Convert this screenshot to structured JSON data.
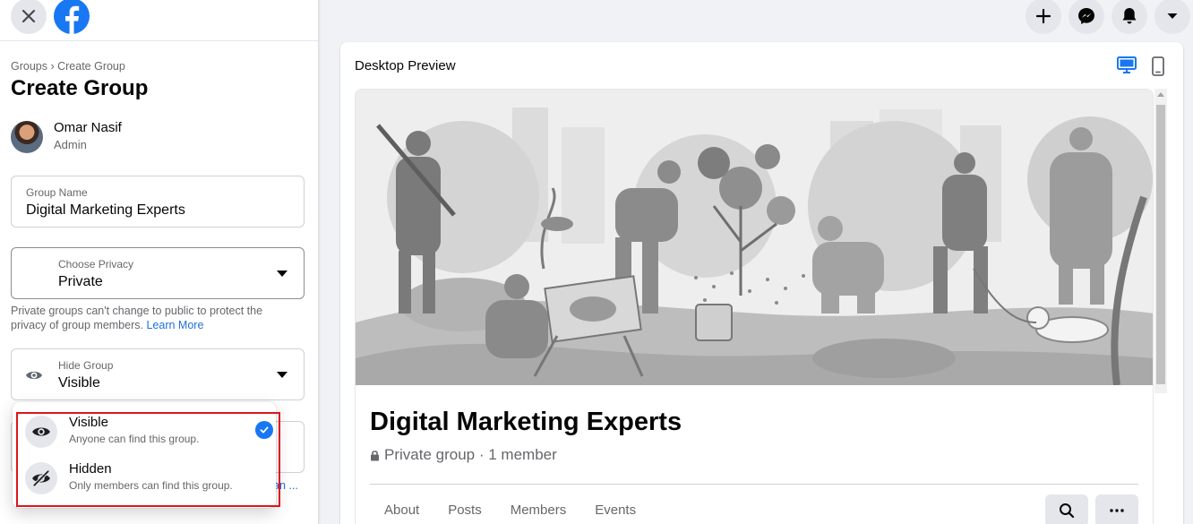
{
  "left_panel": {
    "breadcrumb": "Groups › Create Group",
    "title": "Create Group",
    "user": {
      "name": "Omar Nasif",
      "role": "Admin"
    },
    "group_name_field": {
      "label": "Group Name",
      "value": "Digital Marketing Experts"
    },
    "privacy_field": {
      "label": "Choose Privacy",
      "value": "Private"
    },
    "privacy_note": "Private groups can't change to public to protect the privacy of group members.",
    "privacy_learn_more": "Learn More",
    "hide_field": {
      "label": "Hide Group",
      "value": "Visible"
    },
    "behind_link_fragment": "an ..."
  },
  "dropdown": {
    "options": [
      {
        "title": "Visible",
        "description": "Anyone can find this group.",
        "selected": true,
        "icon": "eye-icon"
      },
      {
        "title": "Hidden",
        "description": "Only members can find this group.",
        "selected": false,
        "icon": "eye-slash-icon"
      }
    ]
  },
  "topbar": {
    "icons": [
      "plus-icon",
      "messenger-icon",
      "bell-icon",
      "caret-down-icon"
    ]
  },
  "preview": {
    "title": "Desktop Preview",
    "group_name": "Digital Marketing Experts",
    "privacy_text": "Private group",
    "member_text": "1 member",
    "separator": " · ",
    "tabs": [
      "About",
      "Posts",
      "Members",
      "Events"
    ]
  },
  "colors": {
    "brand": "#1877f2",
    "highlight": "#e0141e",
    "link": "#216fdb"
  }
}
